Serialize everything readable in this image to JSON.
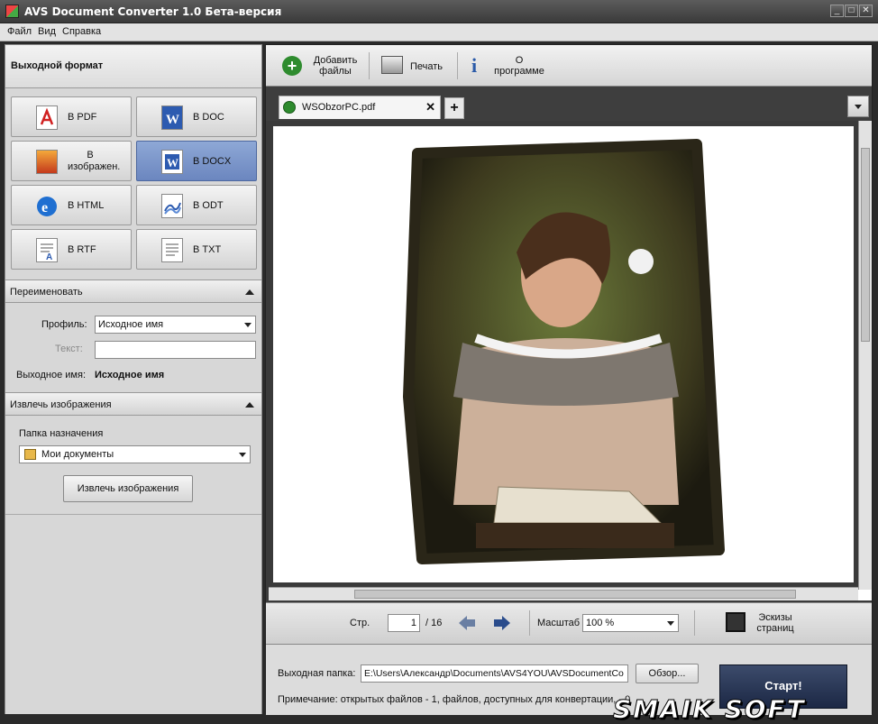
{
  "window": {
    "title": "AVS Document Converter 1.0 Бета-версия",
    "buttons": {
      "minimize": "_",
      "maximize": "□",
      "close": "✕"
    }
  },
  "menu": [
    "Файл",
    "Вид",
    "Справка"
  ],
  "left": {
    "output_format_header": "Выходной формат",
    "formats": [
      {
        "label": "В PDF",
        "icon": "pdf-icon",
        "selected": false
      },
      {
        "label": "В DOC",
        "icon": "doc-icon",
        "selected": false
      },
      {
        "label": "В изображен.",
        "icon": "image-icon",
        "selected": false
      },
      {
        "label": "В DOCX",
        "icon": "docx-icon",
        "selected": true
      },
      {
        "label": "В HTML",
        "icon": "html-icon",
        "selected": false
      },
      {
        "label": "В ODT",
        "icon": "odt-icon",
        "selected": false
      },
      {
        "label": "В RTF",
        "icon": "rtf-icon",
        "selected": false
      },
      {
        "label": "В TXT",
        "icon": "txt-icon",
        "selected": false
      }
    ],
    "rename": {
      "header": "Переименовать",
      "profile_label": "Профиль:",
      "profile_value": "Исходное имя",
      "text_label": "Текст:",
      "text_value": "",
      "output_name_label": "Выходное имя:",
      "output_name_value": "Исходное имя"
    },
    "extract": {
      "header": "Извлечь изображения",
      "dest_label": "Папка назначения",
      "dest_value": "Мои документы",
      "button": "Извлечь изображения"
    }
  },
  "toolbar": {
    "add_files": "Добавить\nфайлы",
    "print": "Печать",
    "about": "О\nпрограмме"
  },
  "tab": {
    "name": "WSObzorPC.pdf",
    "add": "+"
  },
  "nav": {
    "page_label": "Стр.",
    "page_value": "1",
    "page_total": "/ 16",
    "zoom_label": "Масштаб",
    "zoom_value": "100 %",
    "thumbs_label": "Эскизы\nстраниц"
  },
  "bottom": {
    "output_folder_label": "Выходная папка:",
    "output_folder_value": "E:\\Users\\Александр\\Documents\\AVS4YOU\\AVSDocumentCo",
    "browse_button": "Обзор...",
    "start_button": "Старт!",
    "note": "Примечание: открытых файлов - 1, файлов, доступных для конвертации, - 0"
  },
  "watermark": "SMAIK SOFT",
  "colors": {
    "accent": "#6b86bf",
    "start": "#1c2845",
    "dark": "#3a3a3a"
  }
}
